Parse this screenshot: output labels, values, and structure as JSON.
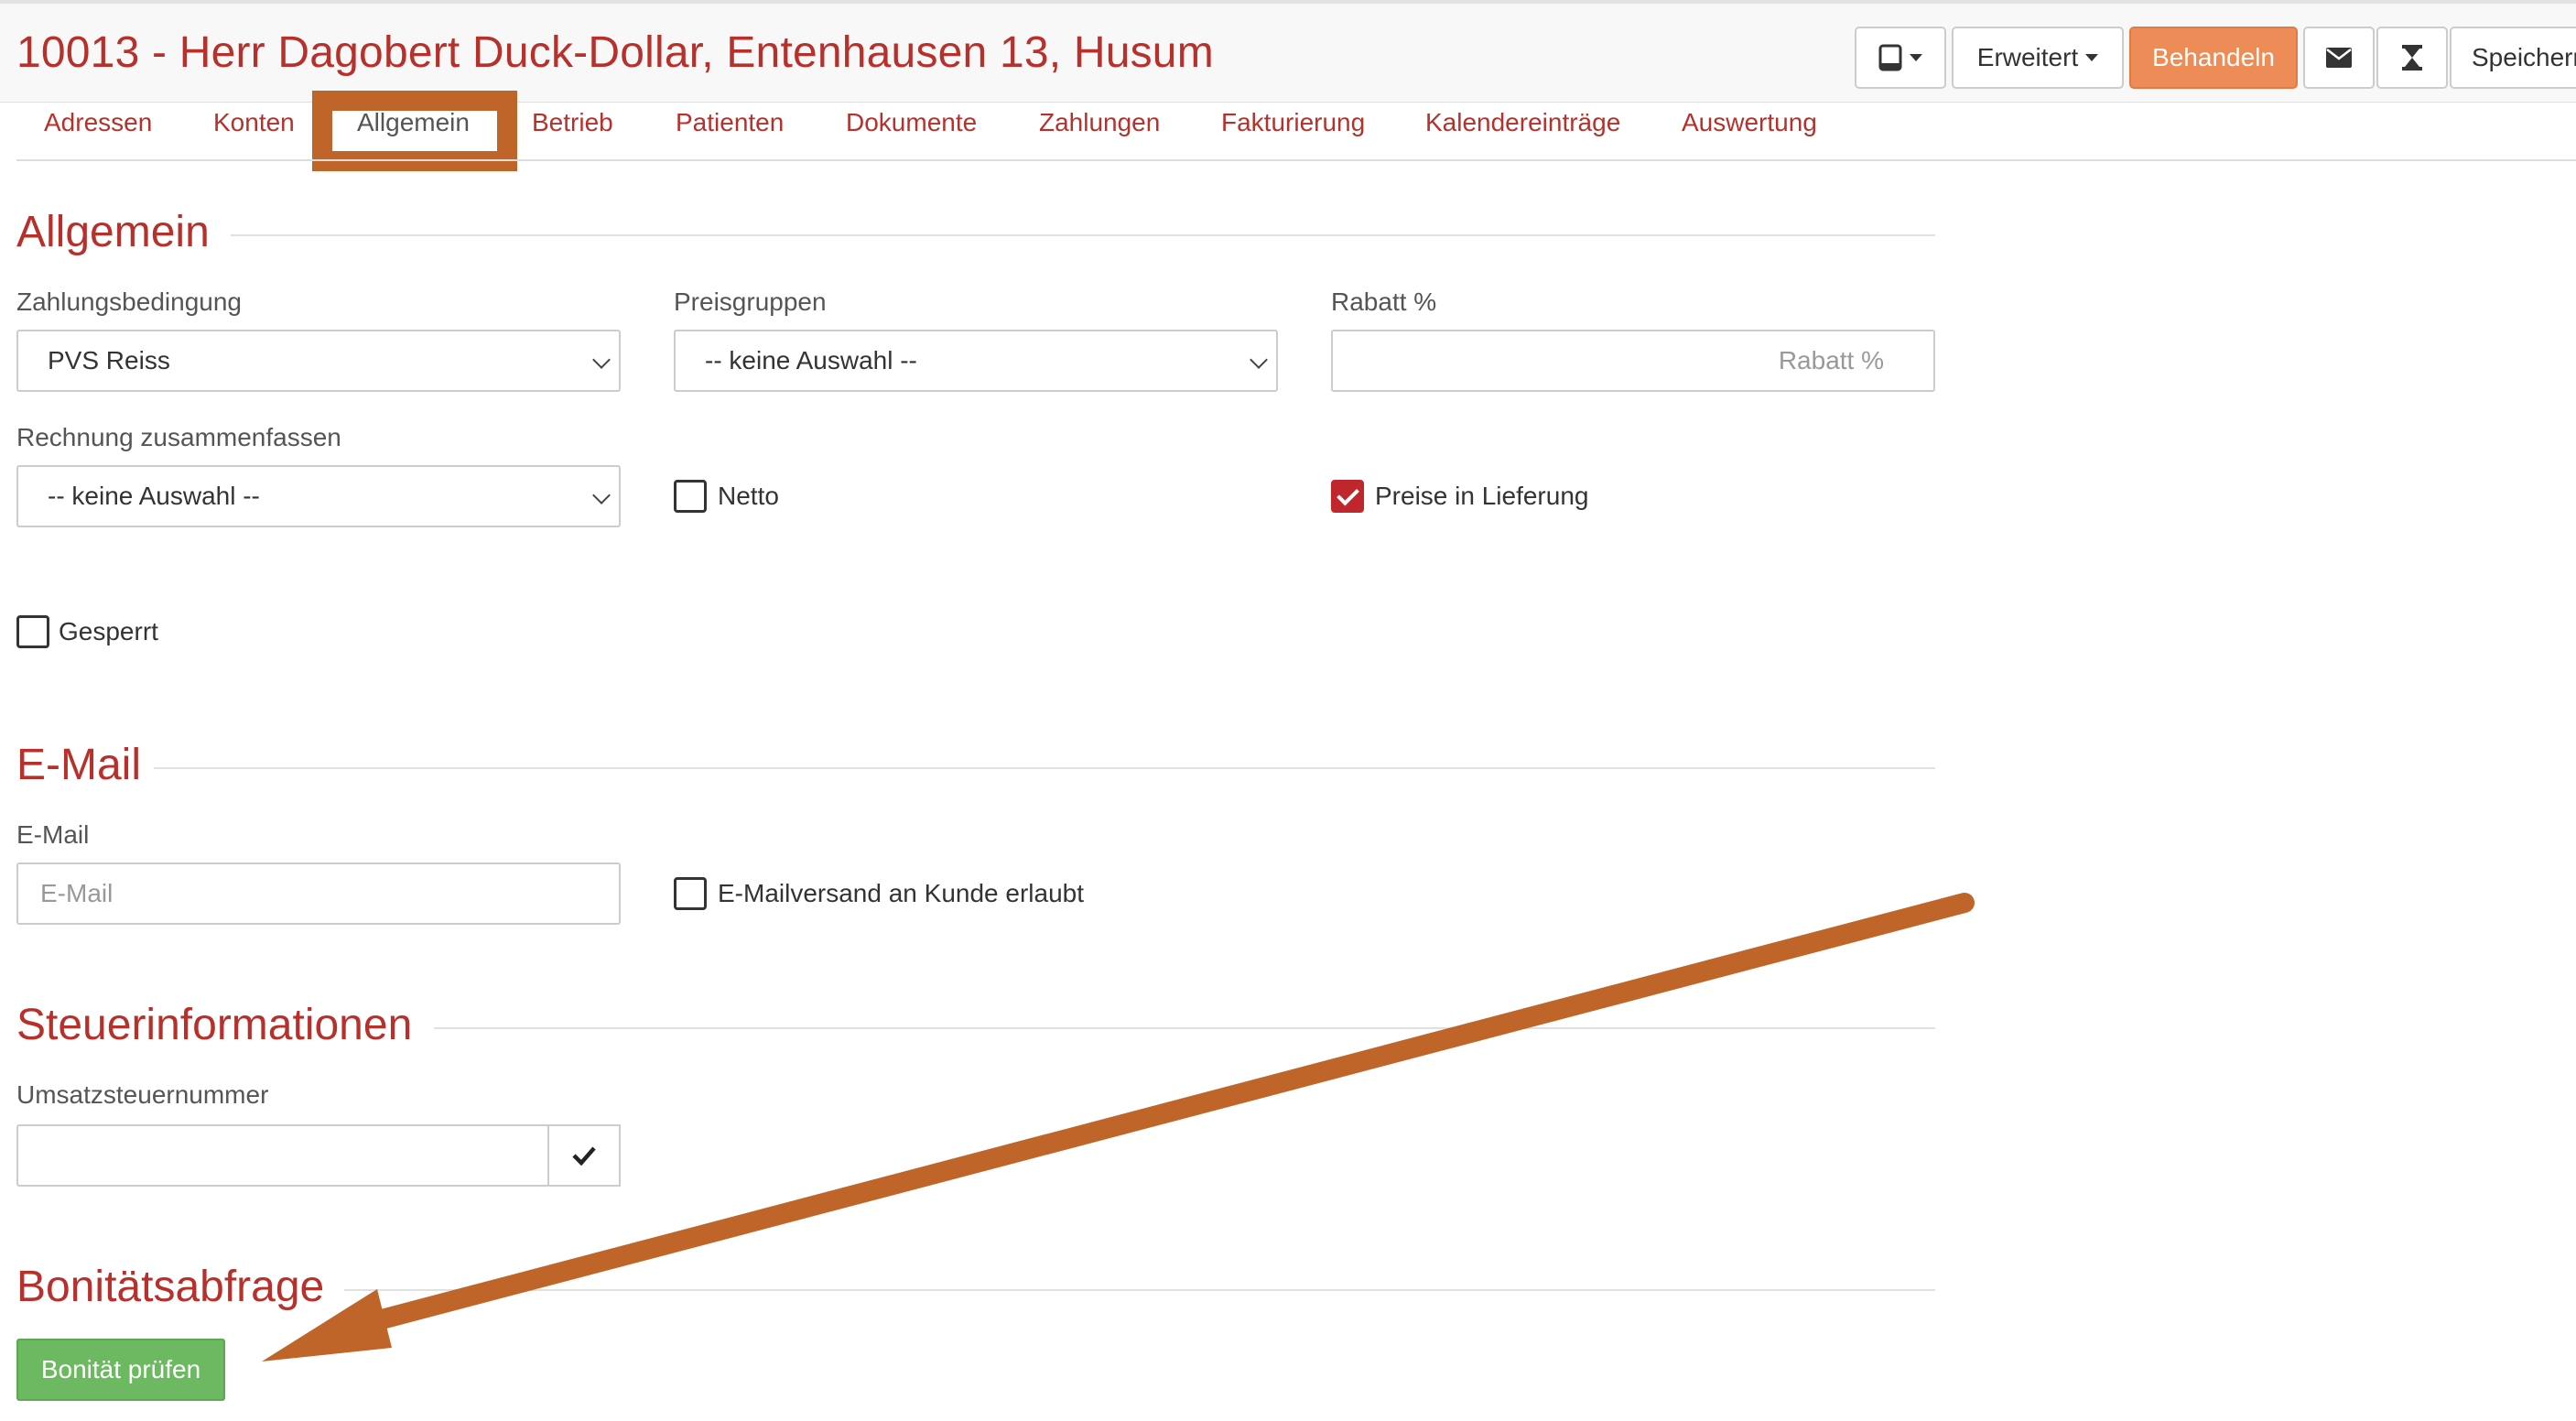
{
  "header": {
    "title": "10013 - Herr Dagobert Duck-Dollar, Entenhausen 13, Husum",
    "buttons": {
      "erweitert": "Erweitert",
      "behandeln": "Behandeln",
      "speichern": "Speichern"
    }
  },
  "tabs": [
    {
      "label": "Adressen"
    },
    {
      "label": "Konten"
    },
    {
      "label": "Allgemein",
      "active": true
    },
    {
      "label": "Betrieb"
    },
    {
      "label": "Patienten"
    },
    {
      "label": "Dokumente"
    },
    {
      "label": "Zahlungen"
    },
    {
      "label": "Fakturierung"
    },
    {
      "label": "Kalendereinträge"
    },
    {
      "label": "Auswertung"
    }
  ],
  "allgemein": {
    "title": "Allgemein",
    "zahlungsbedingung": {
      "label": "Zahlungsbedingung",
      "value": "PVS Reiss"
    },
    "preisgruppen": {
      "label": "Preisgruppen",
      "value": "-- keine Auswahl --"
    },
    "rabatt": {
      "label": "Rabatt %",
      "placeholder": "Rabatt %"
    },
    "rechnung": {
      "label": "Rechnung zusammenfassen",
      "value": "-- keine Auswahl --"
    },
    "netto": {
      "label": "Netto",
      "checked": false
    },
    "preise_lieferung": {
      "label": "Preise in Lieferung",
      "checked": true
    },
    "gesperrt": {
      "label": "Gesperrt",
      "checked": false
    }
  },
  "email": {
    "title": "E-Mail",
    "field": {
      "label": "E-Mail",
      "placeholder": "E-Mail"
    },
    "versand": {
      "label": "E-Mailversand an Kunde erlaubt",
      "checked": false
    }
  },
  "steuer": {
    "title": "Steuerinformationen",
    "ust": {
      "label": "Umsatzsteuernummer",
      "value": ""
    }
  },
  "bonitaet": {
    "title": "Bonitätsabfrage",
    "button": "Bonität prüfen"
  },
  "colors": {
    "accent": "#b7312c",
    "primary_button": "#ee8c58",
    "success_button": "#6cb962",
    "annotation": "#c0652a"
  }
}
